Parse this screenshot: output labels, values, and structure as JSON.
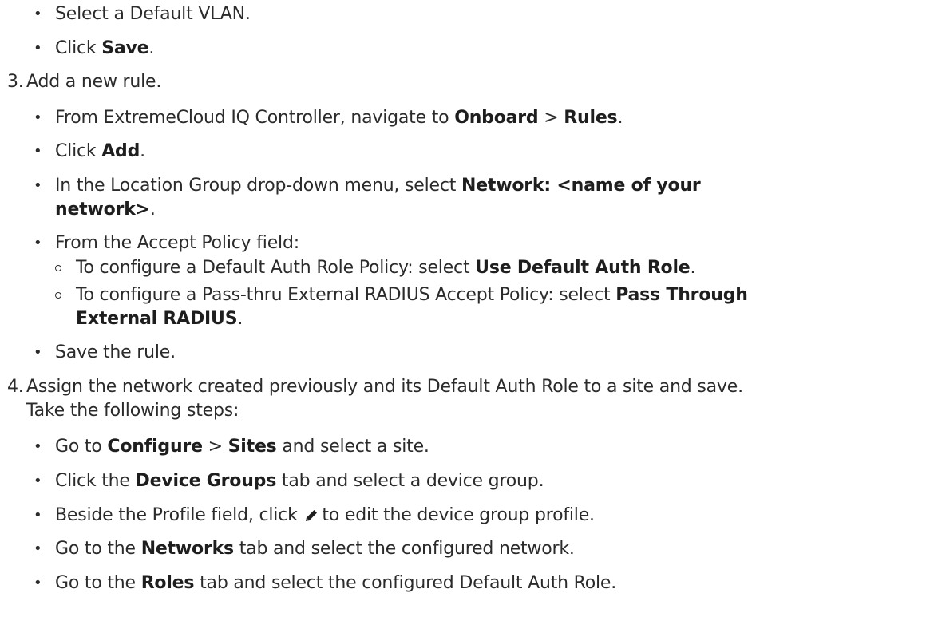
{
  "step2": {
    "items": [
      {
        "text": "Select a Default VLAN."
      },
      {
        "pre": "Click ",
        "bold": "Save",
        "post": "."
      }
    ]
  },
  "step3": {
    "number": "3.",
    "text": "Add a new rule.",
    "items": [
      {
        "pre": "From ExtremeCloud IQ Controller, navigate to ",
        "bold1": "Onboard",
        "mid": " > ",
        "bold2": "Rules",
        "post": "."
      },
      {
        "pre": "Click ",
        "bold": "Add",
        "post": "."
      },
      {
        "pre": "In the Location Group drop-down menu, select ",
        "bold_a": "Network: <name of your",
        "bold_b": "network>",
        "post": "."
      },
      {
        "text": "From the Accept Policy field:"
      },
      {
        "sub": [
          {
            "pre": "To configure a Default Auth Role Policy: select ",
            "bold": "Use Default Auth Role",
            "post": "."
          },
          {
            "pre": "To configure a Pass-thru External RADIUS Accept Policy: select ",
            "bold_a": "Pass Through",
            "bold_b": "External RADIUS",
            "post": "."
          }
        ]
      },
      {
        "text": "Save the rule."
      }
    ]
  },
  "step4": {
    "number": "4.",
    "text_a": "Assign the network created previously and its Default Auth Role to a site and save.",
    "text_b": "Take the following steps:",
    "items": [
      {
        "pre": "Go to ",
        "bold1": "Configure",
        "mid": " > ",
        "bold2": "Sites",
        "post": " and select a site."
      },
      {
        "pre": "Click the ",
        "bold": "Device Groups",
        "post": " tab and select a device group."
      },
      {
        "pre": "Beside the Profile field, click",
        "icon": "pencil-icon",
        "post": "to edit the device group profile."
      },
      {
        "pre": "Go to the ",
        "bold": "Networks",
        "post": " tab and select the configured network."
      },
      {
        "pre": "Go to the ",
        "bold": "Roles",
        "post": " tab and select the configured Default Auth Role."
      }
    ]
  }
}
